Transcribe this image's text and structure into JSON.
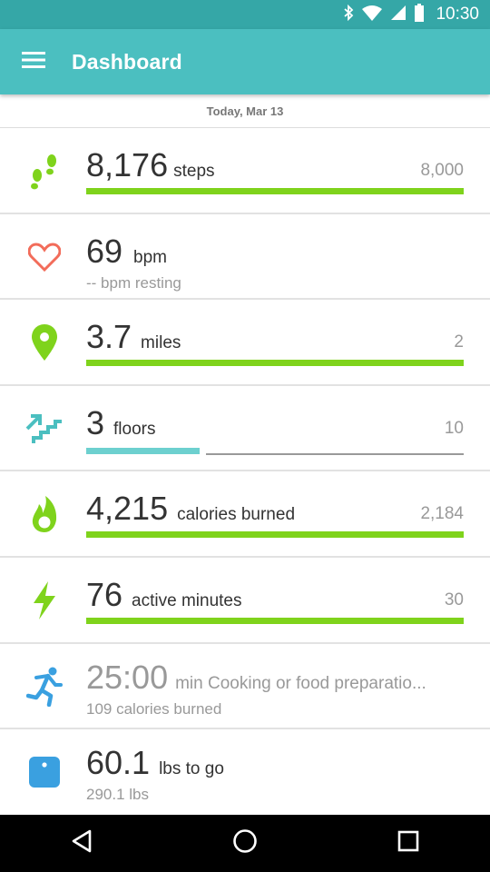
{
  "status_bar": {
    "time": "10:30"
  },
  "app_bar": {
    "title": "Dashboard"
  },
  "date_label": "Today, Mar 13",
  "tiles": {
    "steps": {
      "value": "8,176",
      "unit": "steps",
      "goal": "8,000",
      "progress": 1.0,
      "color": "#7fd31c"
    },
    "heart": {
      "value": "69",
      "unit": "bpm",
      "sub": "-- bpm resting",
      "color": "#f26c5a"
    },
    "distance": {
      "value": "3.7",
      "unit": "miles",
      "goal": "2",
      "progress": 1.0,
      "color": "#7fd31c"
    },
    "floors": {
      "value": "3",
      "unit": "floors",
      "goal": "10",
      "progress": 0.3,
      "color": "#6dd0cf"
    },
    "calories": {
      "value": "4,215",
      "unit": "calories burned",
      "goal": "2,184",
      "progress": 1.0,
      "color": "#7fd31c"
    },
    "active": {
      "value": "76",
      "unit": "active minutes",
      "goal": "30",
      "progress": 1.0,
      "color": "#7fd31c"
    },
    "exercise": {
      "value": "25:00",
      "unit": "min Cooking or food preparatio...",
      "sub": "109 calories burned",
      "color": "#3aa0e0"
    },
    "weight": {
      "value": "60.1",
      "unit": "lbs to go",
      "sub": "290.1 lbs",
      "color": "#3aa0e0"
    }
  },
  "icons": [
    "menu-icon",
    "footsteps-icon",
    "heart-icon",
    "map-pin-icon",
    "stairs-icon",
    "flame-icon",
    "lightning-icon",
    "runner-icon",
    "scale-icon",
    "back-icon",
    "home-icon",
    "recents-icon",
    "bluetooth-icon",
    "wifi-icon",
    "signal-icon",
    "battery-icon"
  ]
}
